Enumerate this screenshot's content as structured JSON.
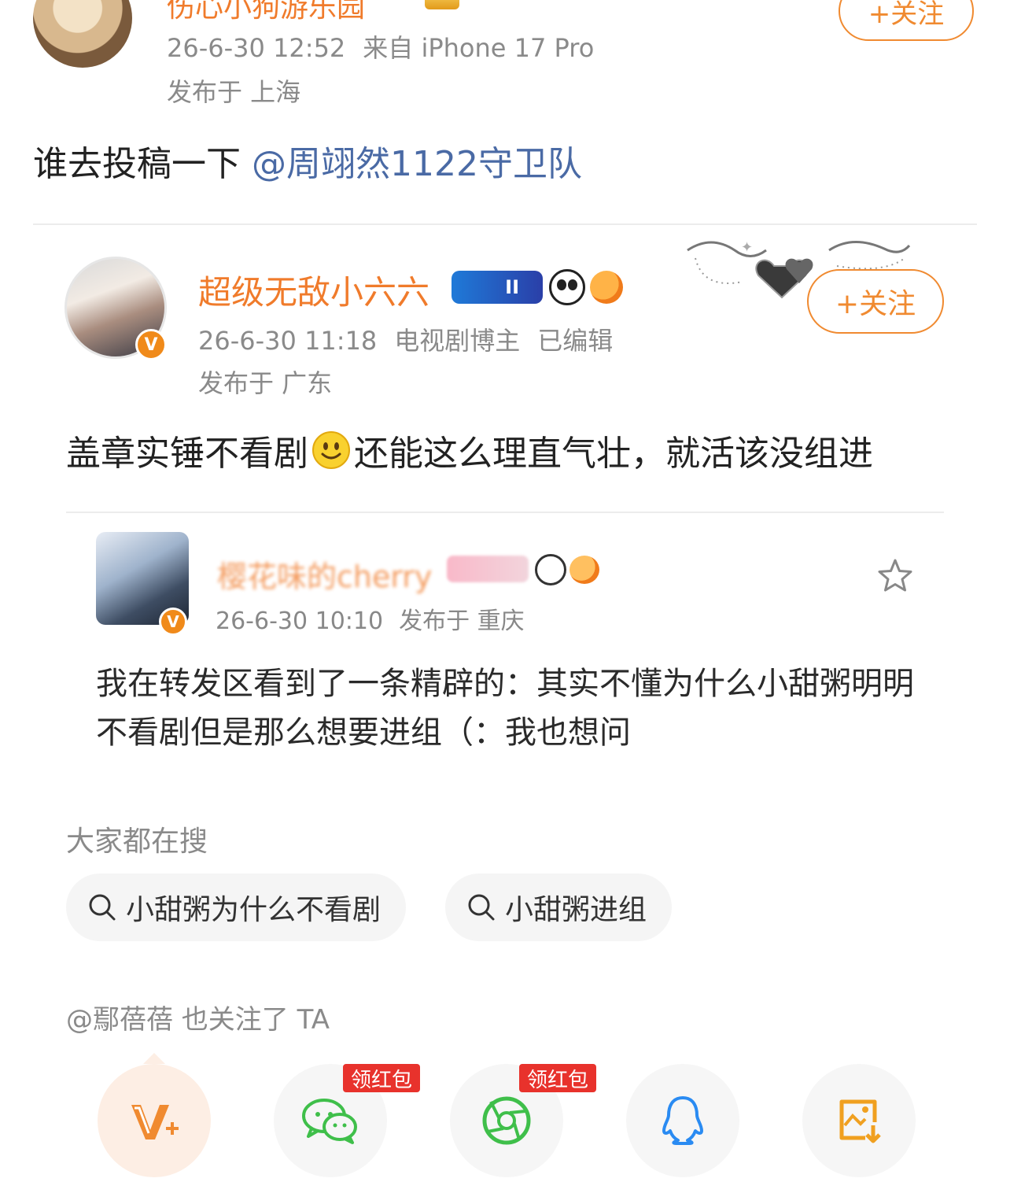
{
  "post": {
    "username": "伤心小狗游乐园",
    "timestamp": "26-6-30 12:52",
    "source": "来自 iPhone 17 Pro",
    "location": "发布于 上海",
    "follow_label": "+关注",
    "text": "谁去投稿一下 ",
    "mention": "@周翊然1122守卫队"
  },
  "retweet": {
    "username": "超级无敌小六六",
    "badge_text": "II",
    "timestamp": "26-6-30 11:18",
    "role": "电视剧博主",
    "edited": "已编辑",
    "location": "发布于 广东",
    "follow_label": "+关注",
    "verified_mark": "V",
    "text_before_emoji": "盖章实锤不看剧",
    "text_after_emoji": "还能这么理直气壮，就活该没组进"
  },
  "nested": {
    "username": "樱花味的cherry",
    "timestamp": "26-6-30 10:10",
    "location": "发布于 重庆",
    "verified_mark": "V",
    "text": "我在转发区看到了一条精辟的：其实不懂为什么小甜粥明明不看剧但是那么想要进组（：我也想问"
  },
  "trending": {
    "title": "大家都在搜",
    "chips": [
      "小甜粥为什么不看剧",
      "小甜粥进组"
    ]
  },
  "also_follows": "@鄢蓓蓓 也关注了 TA",
  "share": {
    "items": [
      "weibo-v-icon",
      "wechat-icon",
      "moments-icon",
      "qq-icon",
      "save-image-icon"
    ],
    "hongbao_label": "领红包"
  },
  "colors": {
    "accent_orange": "#f08a30",
    "mention_blue": "#4a6aa5",
    "hongbao_red": "#e8322c",
    "wechat_green": "#3fbf4a",
    "qq_blue": "#2a8bf2"
  }
}
